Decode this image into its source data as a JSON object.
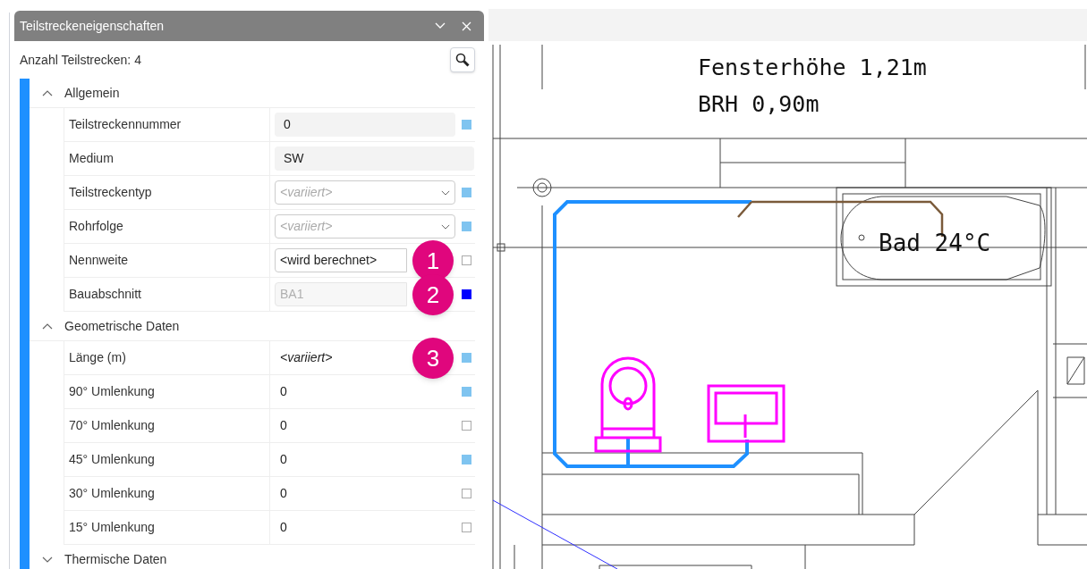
{
  "panel": {
    "title": "Teilstreckeneigenschaften",
    "count_label": "Anzahl Teilstrecken: 4"
  },
  "sections": [
    {
      "title": "Allgemein",
      "expanded": true,
      "rows": [
        {
          "label": "Teilstreckennummer",
          "kind": "readonly",
          "value": "0",
          "marker": {
            "filled": true,
            "color": "#7fc4f0"
          }
        },
        {
          "label": "Medium",
          "kind": "readonly-wide",
          "value": "SW"
        },
        {
          "label": "Teilstreckentyp",
          "kind": "dropdown",
          "placeholder": "<variiert>",
          "marker": {
            "filled": true,
            "color": "#7fc4f0"
          }
        },
        {
          "label": "Rohrfolge",
          "kind": "dropdown",
          "placeholder": "<variiert>",
          "marker": {
            "filled": true,
            "color": "#7fc4f0"
          }
        },
        {
          "label": "Nennweite",
          "kind": "input",
          "value": "<wird berechnet>",
          "marker": {
            "filled": false
          },
          "callout": "1"
        },
        {
          "label": "Bauabschnitt",
          "kind": "disabled",
          "value": "BA1",
          "marker": {
            "filled": true,
            "color": "#0000ff"
          },
          "callout": "2"
        }
      ]
    },
    {
      "title": "Geometrische Daten",
      "expanded": true,
      "rows": [
        {
          "label": "Länge (m)",
          "kind": "varied",
          "value": "<variiert>",
          "marker": {
            "filled": true,
            "color": "#7fc4f0"
          },
          "callout": "3"
        },
        {
          "label": "90° Umlenkung",
          "kind": "plain",
          "value": "0",
          "marker": {
            "filled": true,
            "color": "#7fc4f0"
          }
        },
        {
          "label": "70° Umlenkung",
          "kind": "plain",
          "value": "0",
          "marker": {
            "filled": false
          }
        },
        {
          "label": "45° Umlenkung",
          "kind": "plain",
          "value": "0",
          "marker": {
            "filled": true,
            "color": "#7fc4f0"
          }
        },
        {
          "label": "30° Umlenkung",
          "kind": "plain",
          "value": "0",
          "marker": {
            "filled": false
          }
        },
        {
          "label": "15° Umlenkung",
          "kind": "plain",
          "value": "0",
          "marker": {
            "filled": false
          }
        }
      ]
    },
    {
      "title": "Thermische Daten",
      "expanded": false
    }
  ],
  "drawing": {
    "labels": [
      "Fensterhöhe 1,21m",
      "BRH 0,90m"
    ],
    "room_label": "Bad 24°C"
  }
}
